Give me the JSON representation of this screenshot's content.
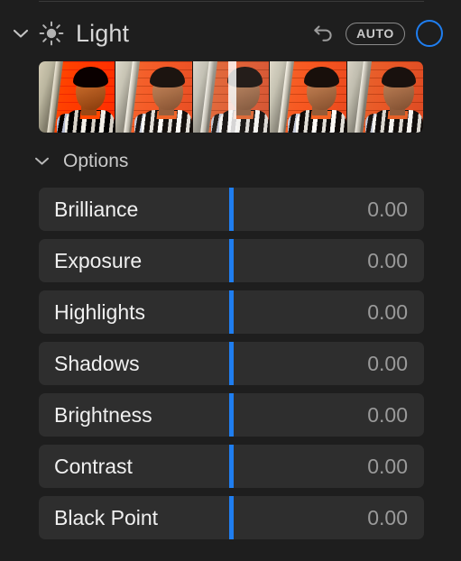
{
  "panel": {
    "background_color": "#1e1e1e",
    "accent_color": "#1f7ef0",
    "row_color": "#2e2e2e"
  },
  "header": {
    "title": "Light",
    "disclosure_icon": "chevron-down-icon",
    "section_icon": "sun-icon",
    "reset_icon": "reset-arrow-icon",
    "auto_label": "AUTO",
    "toggle_icon": "circle-toggle-icon",
    "toggle_state": "on"
  },
  "filmstrip": {
    "selected_index": 2,
    "thumbnail_alt": "portrait-thumbnail",
    "thumbnails": [
      {
        "name": "thumbnail-1",
        "variant": "t1"
      },
      {
        "name": "thumbnail-2",
        "variant": "t2"
      },
      {
        "name": "thumbnail-3",
        "variant": "t3"
      },
      {
        "name": "thumbnail-4",
        "variant": "t4"
      },
      {
        "name": "thumbnail-5",
        "variant": "t5"
      }
    ]
  },
  "options": {
    "label": "Options",
    "disclosure_icon": "chevron-down-icon",
    "expanded": true
  },
  "sliders": [
    {
      "label": "Brilliance",
      "value": "0.00",
      "position_pct": 50
    },
    {
      "label": "Exposure",
      "value": "0.00",
      "position_pct": 50
    },
    {
      "label": "Highlights",
      "value": "0.00",
      "position_pct": 50
    },
    {
      "label": "Shadows",
      "value": "0.00",
      "position_pct": 50
    },
    {
      "label": "Brightness",
      "value": "0.00",
      "position_pct": 50
    },
    {
      "label": "Contrast",
      "value": "0.00",
      "position_pct": 50
    },
    {
      "label": "Black Point",
      "value": "0.00",
      "position_pct": 50
    }
  ]
}
